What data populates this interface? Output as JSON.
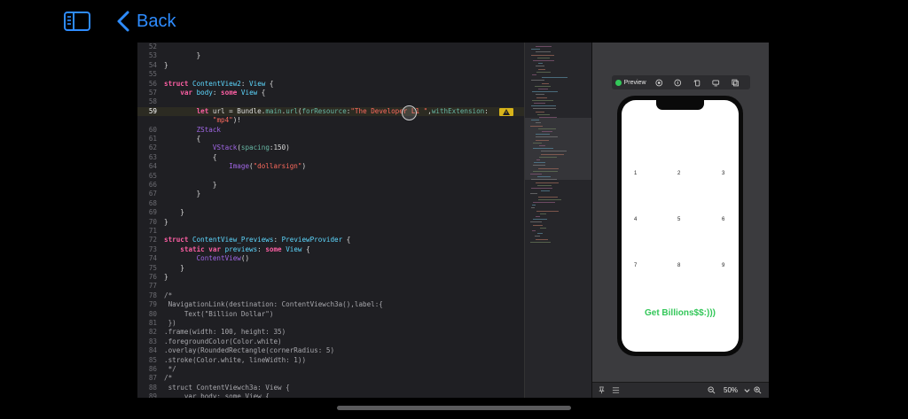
{
  "nav": {
    "back_label": "Back"
  },
  "editor": {
    "lines": [
      {
        "n": "52",
        "html": ""
      },
      {
        "n": "53",
        "html": "        }"
      },
      {
        "n": "54",
        "html": "}"
      },
      {
        "n": "55",
        "html": ""
      },
      {
        "n": "56",
        "html": "<span class='kw'>struct</span> <span class='ty'>ContentView2</span>: <span class='ty'>View</span> {"
      },
      {
        "n": "57",
        "html": "    <span class='kw'>var</span> <span class='ty'>body</span>: <span class='kw'>some</span> <span class='ty'>View</span> {"
      },
      {
        "n": "58",
        "html": ""
      },
      {
        "n": "59",
        "html": "        <span class='kw'>let</span> url = Bundle.<span class='fn'>main</span>.<span class='fn'>url</span>(<span class='fn'>forResource</span>:<span class='str'>\"The Developer L1 \"</span>,<span class='fn'>withExtension</span>:",
        "current": true,
        "warn": true
      },
      {
        "n": "",
        "html": "            <span class='str'>\"mp4\"</span>)!"
      },
      {
        "n": "60",
        "html": "        <span class='prm'>ZStack</span>"
      },
      {
        "n": "61",
        "html": "        {"
      },
      {
        "n": "62",
        "html": "            <span class='prm'>VStack</span>(<span class='fn'>spacing</span>:150)"
      },
      {
        "n": "63",
        "html": "            {"
      },
      {
        "n": "64",
        "html": "                <span class='prm'>Image</span>(<span class='str'>\"dollarsign\"</span>)"
      },
      {
        "n": "65",
        "html": ""
      },
      {
        "n": "66",
        "html": "            }"
      },
      {
        "n": "67",
        "html": "        }"
      },
      {
        "n": "68",
        "html": ""
      },
      {
        "n": "69",
        "html": "    }"
      },
      {
        "n": "70",
        "html": "}"
      },
      {
        "n": "71",
        "html": ""
      },
      {
        "n": "72",
        "html": "<span class='kw'>struct</span> <span class='ty'>ContentView_Previews</span>: <span class='ty'>PreviewProvider</span> {"
      },
      {
        "n": "73",
        "html": "    <span class='kw'>static var</span> <span class='ty'>previews</span>: <span class='kw'>some</span> <span class='ty'>View</span> {"
      },
      {
        "n": "74",
        "html": "        <span class='prm'>ContentView</span>()"
      },
      {
        "n": "75",
        "html": "    }"
      },
      {
        "n": "76",
        "html": "}"
      },
      {
        "n": "77",
        "html": ""
      },
      {
        "n": "78",
        "html": "<span class='cmt'>/*</span>"
      },
      {
        "n": "79",
        "html": "<span class='cmt'> NavigationLink(destination: ContentViewch3a(),label:{</span>"
      },
      {
        "n": "80",
        "html": "<span class='cmt'>     Text(\"Billion Dollar\")</span>"
      },
      {
        "n": "81",
        "html": "<span class='cmt'> })</span>"
      },
      {
        "n": "82",
        "html": "<span class='cmt'>.frame(width: 100, height: 35)</span>"
      },
      {
        "n": "83",
        "html": "<span class='cmt'>.foregroundColor(Color.white)</span>"
      },
      {
        "n": "84",
        "html": "<span class='cmt'>.overlay(RoundedRectangle(cornerRadius: 5)</span>"
      },
      {
        "n": "85",
        "html": "<span class='cmt'>.stroke(Color.white, lineWidth: 1))</span>"
      },
      {
        "n": "86",
        "html": "<span class='cmt'> */</span>"
      },
      {
        "n": "87",
        "html": "<span class='cmt'>/*</span>"
      },
      {
        "n": "88",
        "html": "<span class='cmt'> struct ContentViewch3a: View {</span>"
      },
      {
        "n": "89",
        "html": "<span class='cmt'>     var body: some View {</span>"
      }
    ]
  },
  "preview": {
    "toolbar_label": "Preview",
    "digits": [
      "1",
      "2",
      "3",
      "4",
      "5",
      "6",
      "7",
      "8",
      "9"
    ],
    "button_text": "Get Billions$$:)))",
    "zoom": "50%"
  },
  "colors": {
    "accent": "#2e8cff",
    "preview_green": "#33c759",
    "warning": "#d8b41a"
  }
}
